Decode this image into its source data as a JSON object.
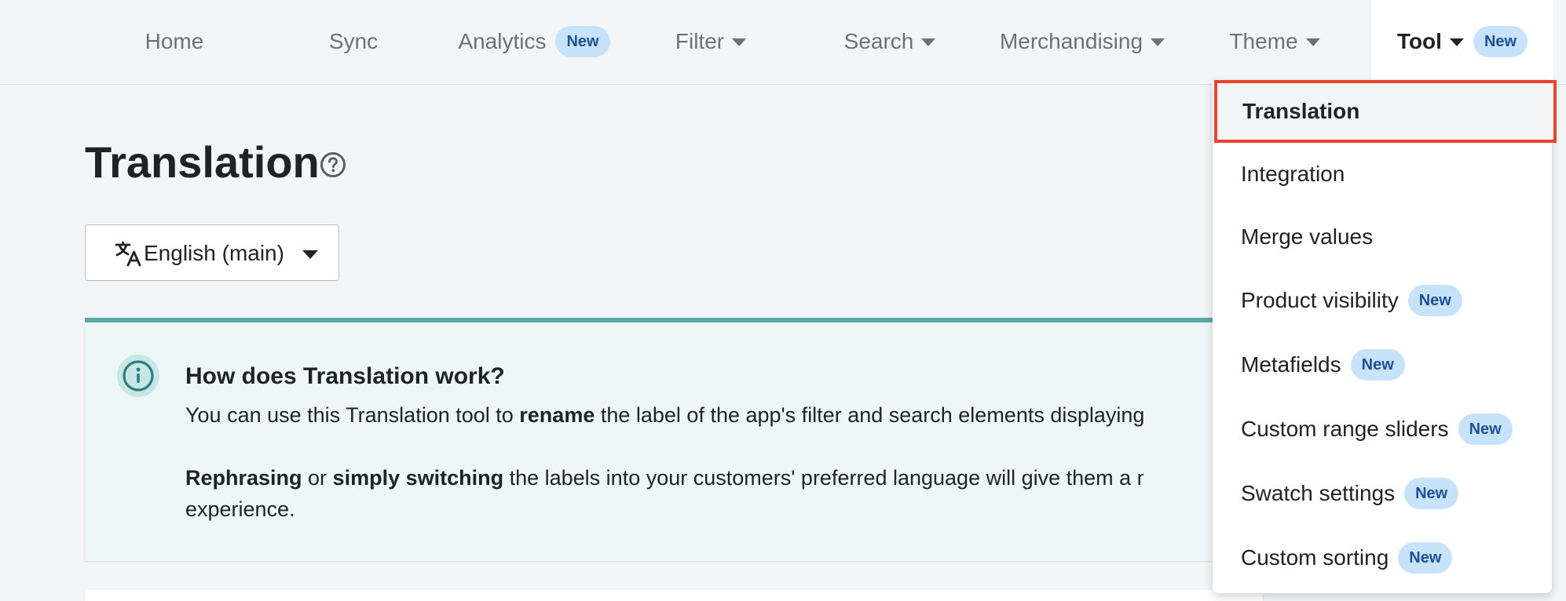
{
  "nav": {
    "items": [
      {
        "label": "Home"
      },
      {
        "label": "Sync"
      },
      {
        "label": "Analytics",
        "badge": "New"
      },
      {
        "label": "Filter"
      },
      {
        "label": "Search"
      },
      {
        "label": "Merchandising"
      },
      {
        "label": "Theme"
      },
      {
        "label": "Tool",
        "badge": "New"
      }
    ],
    "active": "Tool"
  },
  "page": {
    "title": "Translation",
    "help_icon": "question-circle-icon"
  },
  "language_select": {
    "icon": "translate-icon",
    "value": "English (main)"
  },
  "banner": {
    "icon": "info-circle-icon",
    "title": "How does Translation work?",
    "line1_a": "You can use this Translation tool to ",
    "line1_b": "rename",
    "line1_c": " the label of the app's filter and search elements displaying",
    "line2_a": "Rephrasing",
    "line2_b": " or ",
    "line2_c": "simply switching",
    "line2_d": " the labels into your customers' preferred language will give them a r",
    "line3": "experience."
  },
  "tool_menu": {
    "items": [
      {
        "label": "Translation",
        "selected": true
      },
      {
        "label": "Integration"
      },
      {
        "label": "Merge values"
      },
      {
        "label": "Product visibility",
        "badge": "New"
      },
      {
        "label": "Metafields",
        "badge": "New"
      },
      {
        "label": "Custom range sliders",
        "badge": "New"
      },
      {
        "label": "Swatch settings",
        "badge": "New"
      },
      {
        "label": "Custom sorting",
        "badge": "New"
      }
    ]
  },
  "colors": {
    "badge_bg": "#c7e3fa",
    "badge_text": "#1f5199",
    "banner_accent": "#5aa9a8",
    "selection_outline": "#e8452c"
  }
}
